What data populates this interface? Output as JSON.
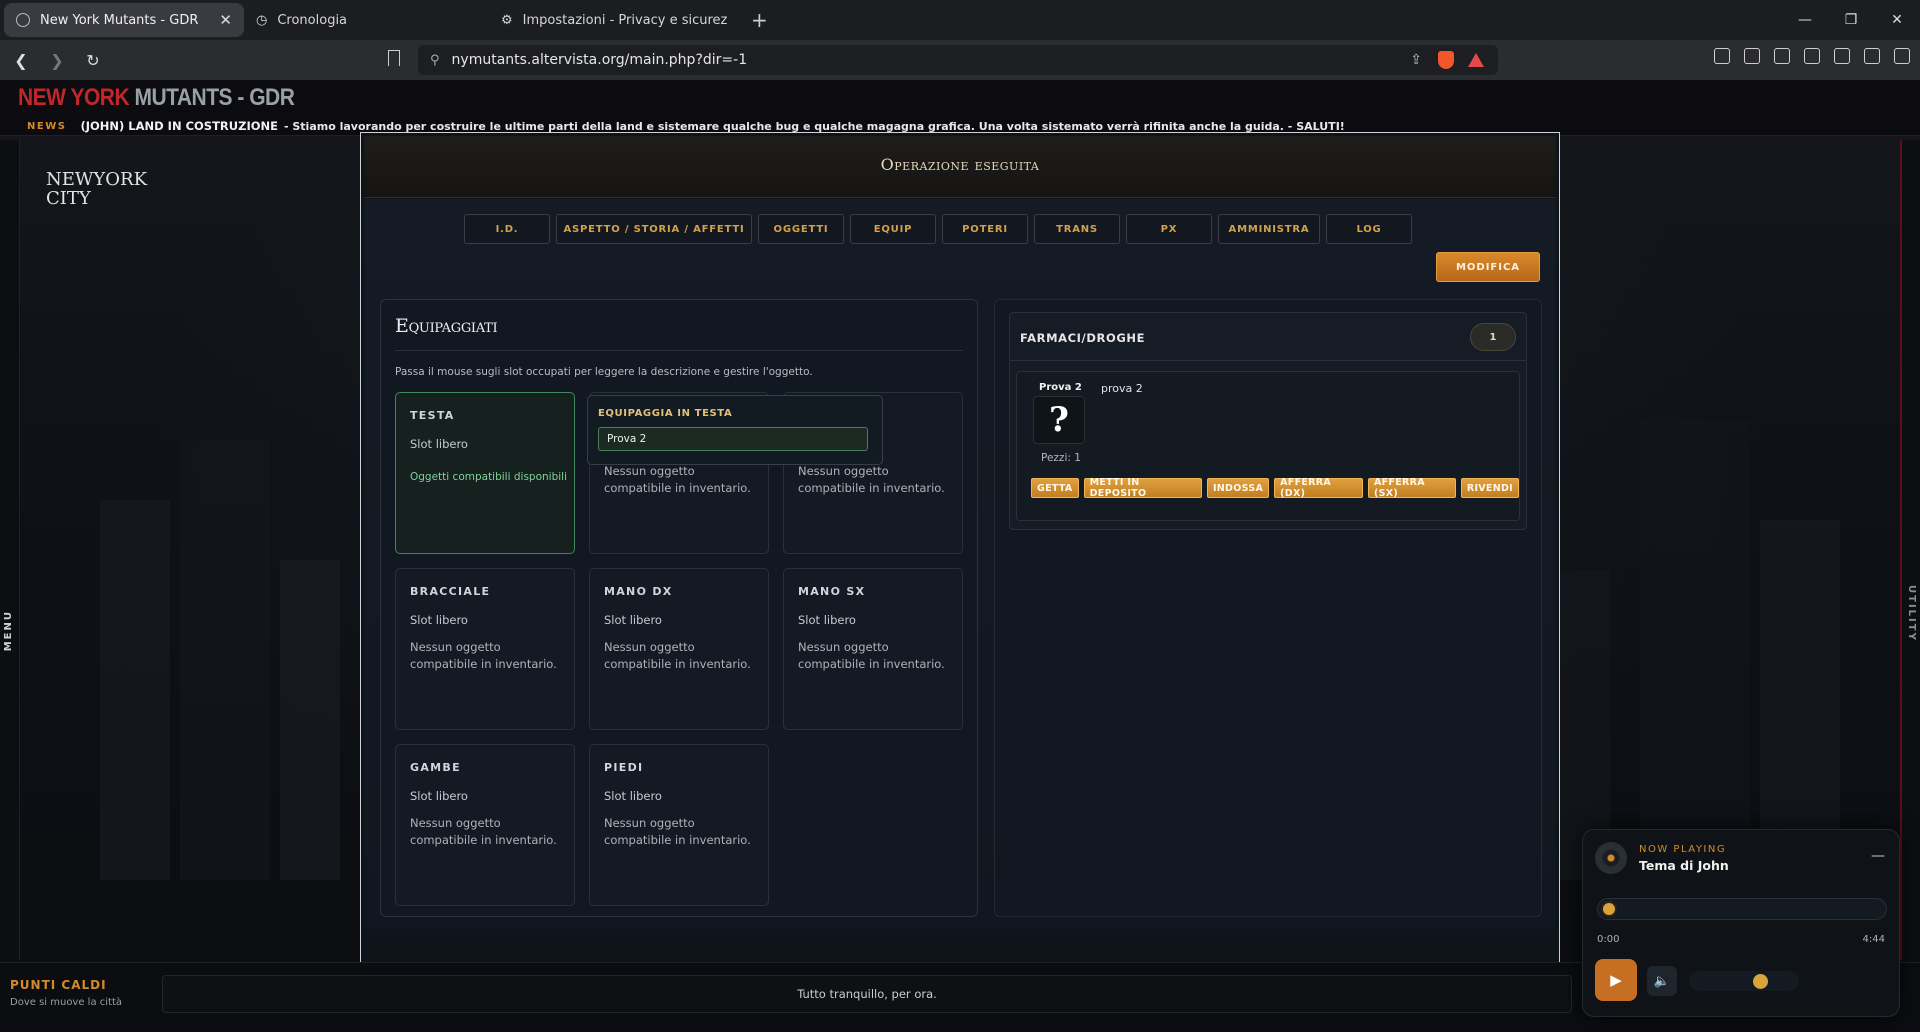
{
  "browser": {
    "tabs": [
      {
        "title": "New York Mutants - GDR",
        "active": true
      },
      {
        "title": "Cronologia",
        "active": false
      },
      {
        "title": "Impostazioni - Privacy e sicurezza",
        "active": false
      }
    ],
    "url": "nymutants.altervista.org/main.php?dir=-1"
  },
  "site": {
    "logo_part1": "NEW YORK",
    "logo_part2": "MUTANTS - GDR",
    "news_tag": "NEWS",
    "news_title": "(JOHN) LAND IN COSTRUZIONE",
    "news_text": "- Stiamo lavorando per costruire le ultime parti della land e sistemare qualche bug e qualche magagna grafica. Una volta sistemato verrà rifinita anche la guida. - SALUTI!",
    "city_title": "NEWYORK CITY",
    "side_menu": "MENU",
    "side_utility": "UTILITY"
  },
  "modal": {
    "title": "Operazione eseguita",
    "tabs": [
      "I.D.",
      "ASPETTO / STORIA / AFFETTI",
      "OGGETTI",
      "EQUIP",
      "POTERI",
      "TRANS",
      "PX",
      "AMMINISTRA",
      "LOG"
    ],
    "modify_label": "MODIFICA",
    "equipped": {
      "title": "Equipaggiati",
      "hint": "Passa il mouse sugli slot occupati per leggere la descrizione e gestire l'oggetto.",
      "slots": [
        {
          "name": "TESTA",
          "state": "Slot libero",
          "note": "Oggetti compatibili disponibili"
        },
        {
          "name": "",
          "state": "",
          "note": "Nessun oggetto compatibile in inventario."
        },
        {
          "name": "",
          "state": "",
          "note": "Nessun oggetto compatibile in inventario."
        },
        {
          "name": "BRACCIALE",
          "state": "Slot libero",
          "note": "Nessun oggetto compatibile in inventario."
        },
        {
          "name": "MANO DX",
          "state": "Slot libero",
          "note": "Nessun oggetto compatibile in inventario."
        },
        {
          "name": "MANO SX",
          "state": "Slot libero",
          "note": "Nessun oggetto compatibile in inventario."
        },
        {
          "name": "GAMBE",
          "state": "Slot libero",
          "note": "Nessun oggetto compatibile in inventario."
        },
        {
          "name": "PIEDI",
          "state": "Slot libero",
          "note": "Nessun oggetto compatibile in inventario."
        }
      ],
      "popup_title": "EQUIPAGGIA IN TESTA",
      "popup_item": "Prova 2"
    },
    "inventory": {
      "category": "FARMACI/DROGHE",
      "count": "1",
      "item": {
        "name": "Prova 2",
        "icon": "?",
        "description": "prova 2",
        "quantity": "Pezzi: 1",
        "actions": [
          "GETTA",
          "METTI IN DEPOSITO",
          "INDOSSA",
          "AFFERRA (DX)",
          "AFFERRA (SX)",
          "RIVENDI"
        ]
      }
    }
  },
  "bottom": {
    "hot_title": "PUNTI CALDI",
    "hot_sub": "Dove si muove la città",
    "status": "Tutto tranquillo, per ora."
  },
  "player": {
    "label": "NOW PLAYING",
    "title": "Tema di John",
    "time_current": "0:00",
    "time_total": "4:44",
    "progress": 0.0,
    "volume": 0.5
  },
  "colors": {
    "accent": "#d38a2a",
    "brand_red": "#c0262a",
    "active_slot": "#3d8a5c"
  }
}
